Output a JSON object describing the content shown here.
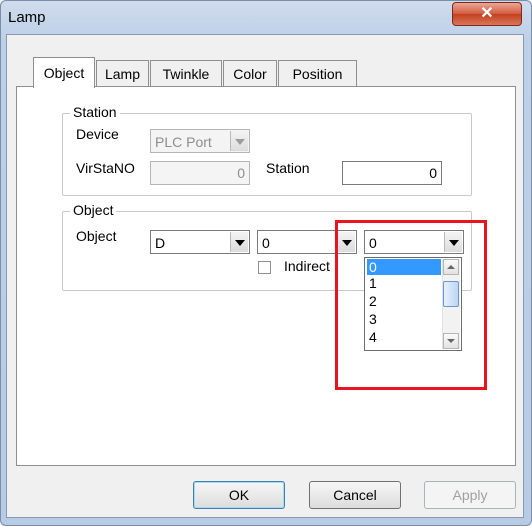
{
  "window": {
    "title": "Lamp",
    "close_glyph": "✕"
  },
  "tabs": [
    {
      "label": "Object",
      "active": true
    },
    {
      "label": "Lamp"
    },
    {
      "label": "Twinkle"
    },
    {
      "label": "Color"
    },
    {
      "label": "Position"
    }
  ],
  "station_group": {
    "title": "Station",
    "device_label": "Device",
    "device_value": "PLC Port",
    "virstano_label": "VirStaNO",
    "virstano_value": "0",
    "station_label": "Station",
    "station_value": "0"
  },
  "object_group": {
    "title": "Object",
    "object_label": "Object",
    "combo1_value": "D",
    "combo2_value": "0",
    "combo3_value": "0",
    "indirect_label": "Indirect",
    "indirect_checked": false,
    "dropdown_options": [
      "0",
      "1",
      "2",
      "3",
      "4"
    ],
    "dropdown_selected": "0"
  },
  "buttons": {
    "ok": "OK",
    "cancel": "Cancel",
    "apply": "Apply"
  },
  "colors": {
    "highlight": "#e8141e",
    "selection": "#3399ff"
  }
}
